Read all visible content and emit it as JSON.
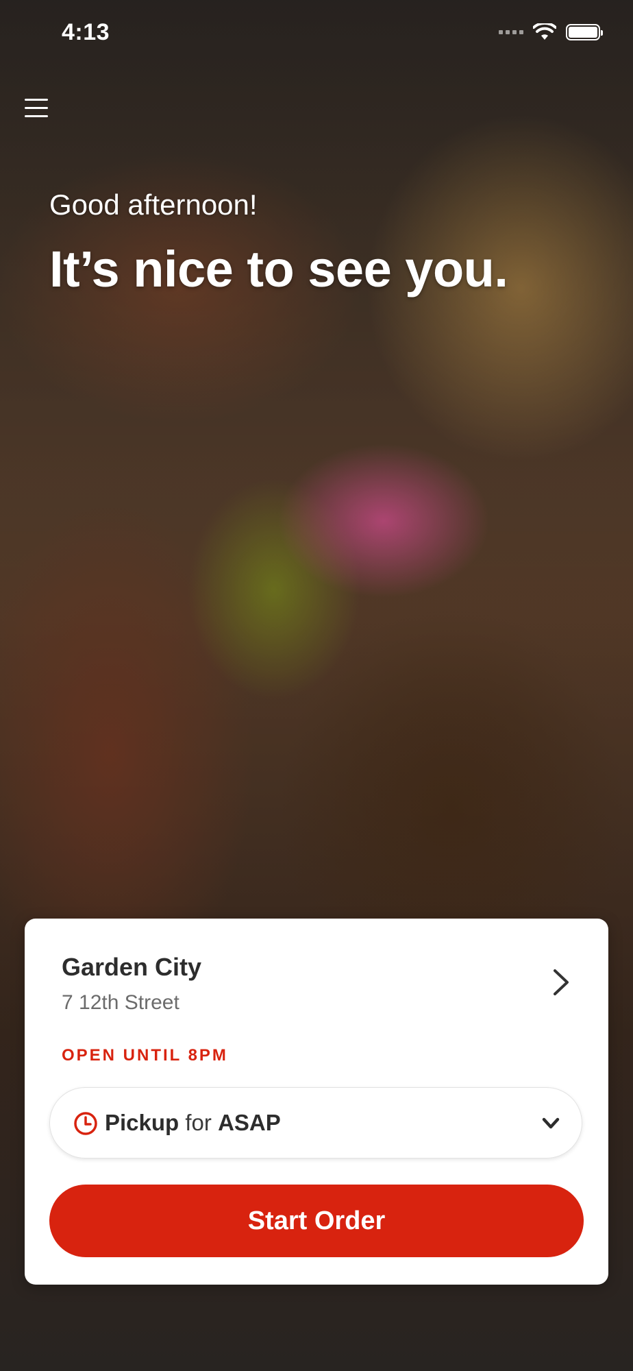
{
  "status_bar": {
    "time": "4:13"
  },
  "header": {
    "greeting": "Good afternoon!",
    "headline": "It’s nice to see you."
  },
  "location": {
    "name": "Garden City",
    "address": "7 12th Street",
    "hours_status": "OPEN UNTIL 8PM"
  },
  "order_mode": {
    "mode": "Pickup",
    "connector": "for",
    "time": "ASAP"
  },
  "actions": {
    "start_order": "Start Order"
  },
  "colors": {
    "accent": "#d8230f",
    "text_dark": "#2d2d2d",
    "text_muted": "#6b6b6b"
  }
}
